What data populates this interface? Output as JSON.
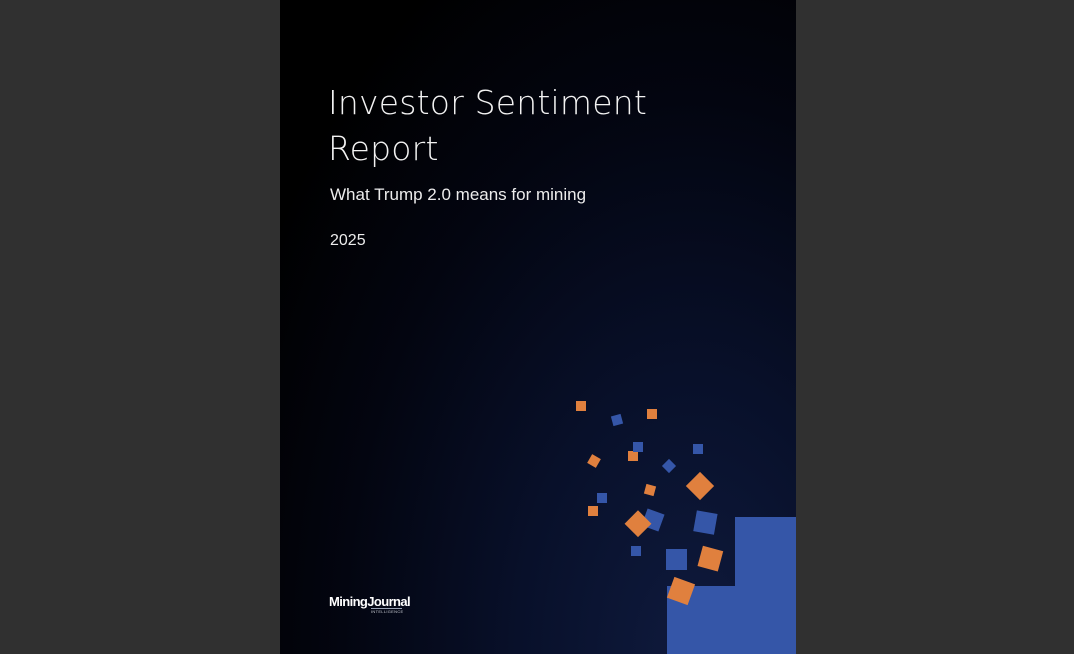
{
  "document": {
    "title": "Investor Sentiment Report",
    "subtitle": "What Trump 2.0 means for mining",
    "year": "2025"
  },
  "logo": {
    "main": "MiningJournal",
    "sub": "INTELLIGENCE"
  },
  "colors": {
    "background_dark": "#000000",
    "accent_blue": "#3556a8",
    "accent_orange": "#e0803e",
    "viewer_bg": "#303030"
  }
}
